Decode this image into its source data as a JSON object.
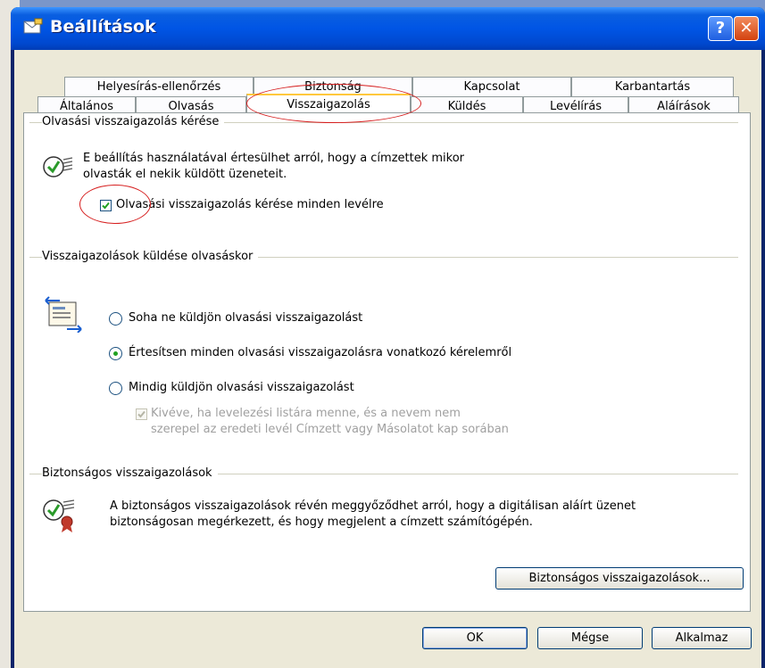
{
  "window": {
    "title": "Beállítások",
    "help_label": "?",
    "close_label": "✕"
  },
  "tabs_row1": [
    "Helyesírás-ellenőrzés",
    "Biztonság",
    "Kapcsolat",
    "Karbantartás"
  ],
  "tabs_row2": [
    "Általános",
    "Olvasás",
    "Visszaigazolás",
    "Küldés",
    "Levélírás",
    "Aláírások"
  ],
  "active_tab": "Visszaigazolás",
  "request_section": {
    "title": "Olvasási visszaigazolás kérése",
    "desc_line1": "E beállítás használatával értesülhet arról, hogy a címzettek mikor",
    "desc_line2": "olvasták el nekik küldött üzeneteit.",
    "checkbox_label": "Olvasási visszaigazolás kérése minden levélre",
    "checkbox_checked": true,
    "icon": "receipt-check-icon"
  },
  "send_section": {
    "title": "Visszaigazolások küldése olvasáskor",
    "options": [
      "Soha ne küldjön olvasási visszaigazolást",
      "Értesítsen minden olvasási visszaigazolásra vonatkozó kérelemről",
      "Mindig küldjön olvasási visszaigazolást"
    ],
    "selected_option": 1,
    "except_line1": "Kivéve, ha levelezési listára menne, és a nevem nem",
    "except_line2": "szerepel az eredeti levél Címzett vagy Másolatot kap sorában",
    "except_checked": true,
    "icon": "receipt-send-icon"
  },
  "secure_section": {
    "title": "Biztonságos visszaigazolások",
    "desc_line1": "A biztonságos visszaigazolások révén meggyőződhet arról, hogy a digitálisan aláírt üzenet",
    "desc_line2": "biztonságosan megérkezett, és hogy megjelent a címzett számítógépén.",
    "button_label": "Biztonságos visszaigazolások...",
    "icon": "secure-receipt-icon"
  },
  "footer": {
    "ok_label": "OK",
    "cancel_label": "Mégse",
    "apply_label": "Alkalmaz"
  },
  "colors": {
    "title_blue": "#0055e5",
    "annotation_red": "#d61f1f",
    "panel_bg": "#ece9d8"
  }
}
